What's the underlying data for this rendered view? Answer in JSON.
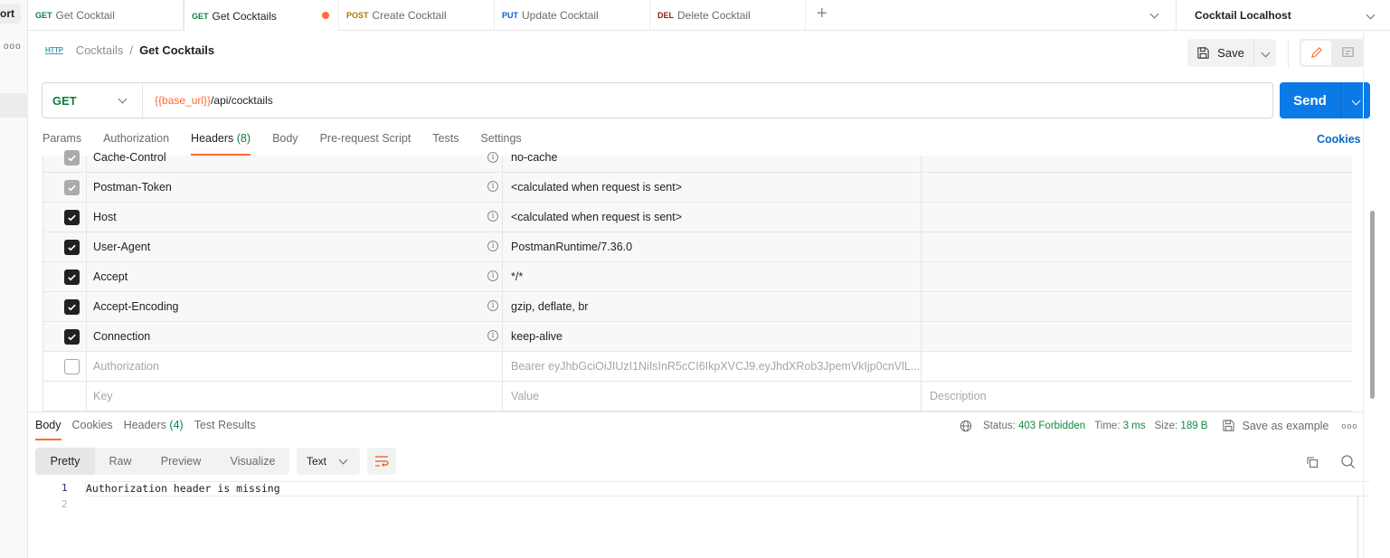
{
  "sidebar": {
    "import_label": "ort",
    "more_label": "ooo"
  },
  "tabs": [
    {
      "method": "GET",
      "method_color": "#0f7d3f",
      "label": "Get Cocktail",
      "active": false
    },
    {
      "method": "GET",
      "method_color": "#0f7d3f",
      "label": "Get Cocktails",
      "active": true,
      "unsaved": true
    },
    {
      "method": "POST",
      "method_color": "#ad7a03",
      "label": "Create Cocktail",
      "active": false
    },
    {
      "method": "PUT",
      "method_color": "#0b5fc4",
      "label": "Update Cocktail",
      "active": false
    },
    {
      "method": "DEL",
      "method_color": "#8e1a10",
      "label": "Delete Cocktail",
      "active": false
    }
  ],
  "environment": {
    "selected": "Cocktail Localhost"
  },
  "breadcrumb": {
    "icon": "HTTP",
    "parent": "Cocktails",
    "separator": "/",
    "current": "Get Cocktails"
  },
  "toolbar": {
    "save_label": "Save"
  },
  "request": {
    "method": "GET",
    "url_variable": "{{base_url}}",
    "url_path": "/api/cocktails",
    "send_label": "Send"
  },
  "request_tabs": [
    {
      "label": "Params"
    },
    {
      "label": "Authorization"
    },
    {
      "label": "Headers",
      "count": "(8)",
      "active": true
    },
    {
      "label": "Body"
    },
    {
      "label": "Pre-request Script"
    },
    {
      "label": "Tests"
    },
    {
      "label": "Settings"
    }
  ],
  "cookies_link": "Cookies",
  "headers": [
    {
      "key": "Cache-Control",
      "value": "no-cache",
      "state": "auto"
    },
    {
      "key": "Postman-Token",
      "value": "<calculated when request is sent>",
      "state": "auto"
    },
    {
      "key": "Host",
      "value": "<calculated when request is sent>",
      "state": "checked"
    },
    {
      "key": "User-Agent",
      "value": "PostmanRuntime/7.36.0",
      "state": "checked"
    },
    {
      "key": "Accept",
      "value": "*/*",
      "state": "checked"
    },
    {
      "key": "Accept-Encoding",
      "value": "gzip, deflate, br",
      "state": "checked"
    },
    {
      "key": "Connection",
      "value": "keep-alive",
      "state": "checked"
    },
    {
      "key": "Authorization",
      "value": "Bearer eyJhbGciOiJIUzI1NiIsInR5cCI6IkpXVCJ9.eyJhdXRob3JpemVkIjp0cnVlL...",
      "state": "unchecked"
    }
  ],
  "header_placeholders": {
    "key": "Key",
    "value": "Value",
    "description": "Description"
  },
  "response_tabs": [
    {
      "label": "Body",
      "active": true
    },
    {
      "label": "Cookies"
    },
    {
      "label": "Headers",
      "count": "(4)"
    },
    {
      "label": "Test Results"
    }
  ],
  "response_status": {
    "status_label": "Status:",
    "status_value": "403 Forbidden",
    "time_label": "Time:",
    "time_value": "3 ms",
    "size_label": "Size:",
    "size_value": "189 B",
    "save_example_label": "Save as example",
    "more_label": "ooo"
  },
  "view_modes": [
    {
      "label": "Pretty",
      "active": true
    },
    {
      "label": "Raw"
    },
    {
      "label": "Preview"
    },
    {
      "label": "Visualize"
    }
  ],
  "format": {
    "selected": "Text"
  },
  "response_body": {
    "lines": [
      {
        "number": "1",
        "text": "Authorization header is missing"
      },
      {
        "number": "2",
        "text": ""
      }
    ]
  }
}
